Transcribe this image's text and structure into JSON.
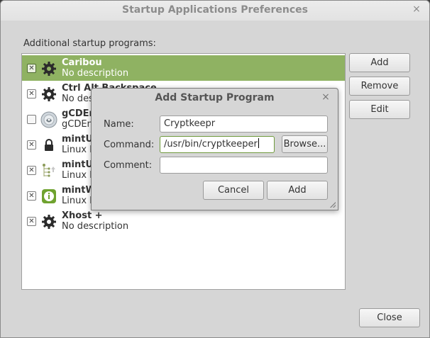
{
  "window": {
    "title": "Startup Applications Preferences",
    "close_glyph": "×",
    "section_label": "Additional startup programs:",
    "buttons": {
      "add": "Add",
      "remove": "Remove",
      "edit": "Edit",
      "close": "Close"
    }
  },
  "programs": [
    {
      "name": "Caribou",
      "description": "No description",
      "checked": true,
      "selected": true,
      "icon": "gear-icon"
    },
    {
      "name": "Ctrl Alt Backspace",
      "description": "No desc",
      "checked": true,
      "selected": false,
      "icon": "gear-icon"
    },
    {
      "name": "gCDEm",
      "description": "gCDEm",
      "checked": false,
      "selected": false,
      "icon": "gcdemu-disc-icon"
    },
    {
      "name": "mintU",
      "description": "Linux M",
      "checked": true,
      "selected": false,
      "icon": "lock-icon"
    },
    {
      "name": "mintU",
      "description": "Linux M",
      "checked": true,
      "selected": false,
      "icon": "tree-icon"
    },
    {
      "name": "mintW",
      "description": "Linux M",
      "checked": true,
      "selected": false,
      "icon": "info-icon"
    },
    {
      "name": "Xhost +",
      "description": "No description",
      "checked": true,
      "selected": false,
      "icon": "gear-icon"
    }
  ],
  "check_glyph": "✕",
  "dialog": {
    "title": "Add Startup Program",
    "close_glyph": "×",
    "name_label": "Name:",
    "name_value": "Cryptkeepr",
    "command_label": "Command:",
    "command_value": "/usr/bin/cryptkeeper",
    "comment_label": "Comment:",
    "comment_value": "",
    "browse_label": "Browse...",
    "cancel_label": "Cancel",
    "add_label": "Add"
  },
  "colors": {
    "selection": "#8fb262",
    "window_bg": "#d6d6d6",
    "focus_border": "#6f9a3c"
  }
}
